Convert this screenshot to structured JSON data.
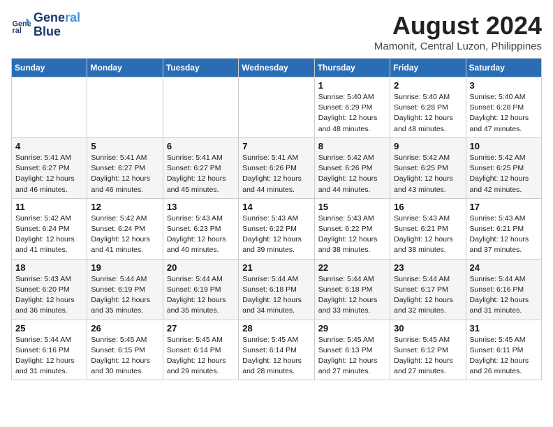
{
  "header": {
    "logo_line1": "General",
    "logo_line2": "Blue",
    "month_title": "August 2024",
    "location": "Mamonit, Central Luzon, Philippines"
  },
  "weekdays": [
    "Sunday",
    "Monday",
    "Tuesday",
    "Wednesday",
    "Thursday",
    "Friday",
    "Saturday"
  ],
  "weeks": [
    [
      null,
      null,
      null,
      null,
      {
        "day": 1,
        "sunrise": "5:40 AM",
        "sunset": "6:29 PM",
        "daylight": "12 hours and 48 minutes."
      },
      {
        "day": 2,
        "sunrise": "5:40 AM",
        "sunset": "6:28 PM",
        "daylight": "12 hours and 48 minutes."
      },
      {
        "day": 3,
        "sunrise": "5:40 AM",
        "sunset": "6:28 PM",
        "daylight": "12 hours and 47 minutes."
      }
    ],
    [
      {
        "day": 4,
        "sunrise": "5:41 AM",
        "sunset": "6:27 PM",
        "daylight": "12 hours and 46 minutes."
      },
      {
        "day": 5,
        "sunrise": "5:41 AM",
        "sunset": "6:27 PM",
        "daylight": "12 hours and 46 minutes."
      },
      {
        "day": 6,
        "sunrise": "5:41 AM",
        "sunset": "6:27 PM",
        "daylight": "12 hours and 45 minutes."
      },
      {
        "day": 7,
        "sunrise": "5:41 AM",
        "sunset": "6:26 PM",
        "daylight": "12 hours and 44 minutes."
      },
      {
        "day": 8,
        "sunrise": "5:42 AM",
        "sunset": "6:26 PM",
        "daylight": "12 hours and 44 minutes."
      },
      {
        "day": 9,
        "sunrise": "5:42 AM",
        "sunset": "6:25 PM",
        "daylight": "12 hours and 43 minutes."
      },
      {
        "day": 10,
        "sunrise": "5:42 AM",
        "sunset": "6:25 PM",
        "daylight": "12 hours and 42 minutes."
      }
    ],
    [
      {
        "day": 11,
        "sunrise": "5:42 AM",
        "sunset": "6:24 PM",
        "daylight": "12 hours and 41 minutes."
      },
      {
        "day": 12,
        "sunrise": "5:42 AM",
        "sunset": "6:24 PM",
        "daylight": "12 hours and 41 minutes."
      },
      {
        "day": 13,
        "sunrise": "5:43 AM",
        "sunset": "6:23 PM",
        "daylight": "12 hours and 40 minutes."
      },
      {
        "day": 14,
        "sunrise": "5:43 AM",
        "sunset": "6:22 PM",
        "daylight": "12 hours and 39 minutes."
      },
      {
        "day": 15,
        "sunrise": "5:43 AM",
        "sunset": "6:22 PM",
        "daylight": "12 hours and 38 minutes."
      },
      {
        "day": 16,
        "sunrise": "5:43 AM",
        "sunset": "6:21 PM",
        "daylight": "12 hours and 38 minutes."
      },
      {
        "day": 17,
        "sunrise": "5:43 AM",
        "sunset": "6:21 PM",
        "daylight": "12 hours and 37 minutes."
      }
    ],
    [
      {
        "day": 18,
        "sunrise": "5:43 AM",
        "sunset": "6:20 PM",
        "daylight": "12 hours and 36 minutes."
      },
      {
        "day": 19,
        "sunrise": "5:44 AM",
        "sunset": "6:19 PM",
        "daylight": "12 hours and 35 minutes."
      },
      {
        "day": 20,
        "sunrise": "5:44 AM",
        "sunset": "6:19 PM",
        "daylight": "12 hours and 35 minutes."
      },
      {
        "day": 21,
        "sunrise": "5:44 AM",
        "sunset": "6:18 PM",
        "daylight": "12 hours and 34 minutes."
      },
      {
        "day": 22,
        "sunrise": "5:44 AM",
        "sunset": "6:18 PM",
        "daylight": "12 hours and 33 minutes."
      },
      {
        "day": 23,
        "sunrise": "5:44 AM",
        "sunset": "6:17 PM",
        "daylight": "12 hours and 32 minutes."
      },
      {
        "day": 24,
        "sunrise": "5:44 AM",
        "sunset": "6:16 PM",
        "daylight": "12 hours and 31 minutes."
      }
    ],
    [
      {
        "day": 25,
        "sunrise": "5:44 AM",
        "sunset": "6:16 PM",
        "daylight": "12 hours and 31 minutes."
      },
      {
        "day": 26,
        "sunrise": "5:45 AM",
        "sunset": "6:15 PM",
        "daylight": "12 hours and 30 minutes."
      },
      {
        "day": 27,
        "sunrise": "5:45 AM",
        "sunset": "6:14 PM",
        "daylight": "12 hours and 29 minutes."
      },
      {
        "day": 28,
        "sunrise": "5:45 AM",
        "sunset": "6:14 PM",
        "daylight": "12 hours and 28 minutes."
      },
      {
        "day": 29,
        "sunrise": "5:45 AM",
        "sunset": "6:13 PM",
        "daylight": "12 hours and 27 minutes."
      },
      {
        "day": 30,
        "sunrise": "5:45 AM",
        "sunset": "6:12 PM",
        "daylight": "12 hours and 27 minutes."
      },
      {
        "day": 31,
        "sunrise": "5:45 AM",
        "sunset": "6:11 PM",
        "daylight": "12 hours and 26 minutes."
      }
    ]
  ]
}
